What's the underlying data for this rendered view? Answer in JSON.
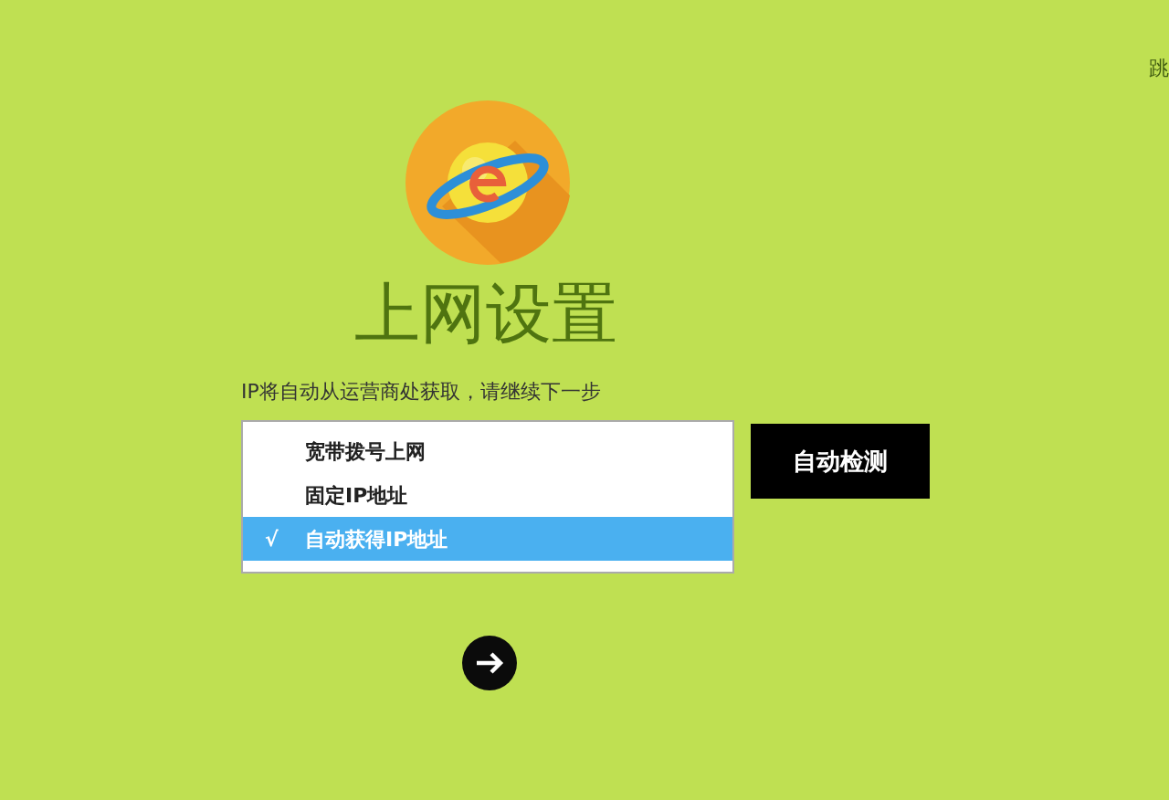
{
  "skip_link": "跳",
  "title": "上网设置",
  "hint": "IP将自动从运营商处获取，请继续下一步",
  "connection_list": {
    "check_mark": "√",
    "items": [
      {
        "label": "宽带拨号上网",
        "selected": false
      },
      {
        "label": "固定IP地址",
        "selected": false
      },
      {
        "label": "自动获得IP地址",
        "selected": true
      }
    ]
  },
  "detect_button": "自动检测"
}
